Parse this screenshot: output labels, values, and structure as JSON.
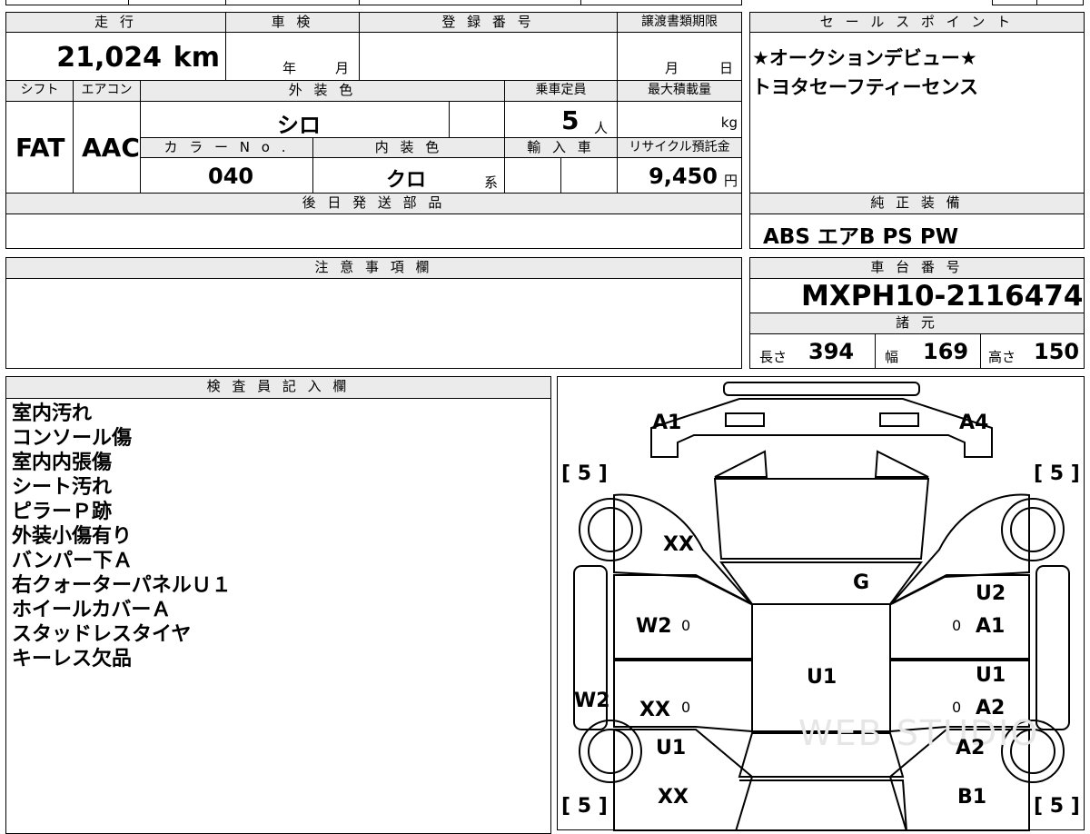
{
  "top": {
    "mileage_label": "走 行",
    "mileage_value": "21,024",
    "mileage_unit": "km",
    "inspection_label": "車 検",
    "inspection_year": "年",
    "inspection_month": "月",
    "registration_label": "登 録 番 号",
    "transfer_label": "譲渡書類期限",
    "transfer_month": "月",
    "transfer_day": "日"
  },
  "row2": {
    "shift_label": "シフト",
    "shift_value": "FAT",
    "ac_label": "エアコン",
    "ac_value": "AAC",
    "exterior_label": "外 装 色",
    "exterior_value": "シロ",
    "capacity_label": "乗車定員",
    "capacity_value": "5",
    "capacity_unit": "人",
    "maxload_label": "最大積載量",
    "maxload_unit": "kg",
    "color_no_label": "カ ラ ー N o .",
    "color_no_value": "040",
    "interior_label": "内 装 色",
    "interior_value": "クロ",
    "interior_suffix": "系",
    "import_label": "輸 入 車",
    "recycle_label": "リサイクル預託金",
    "recycle_value": "9,450",
    "recycle_unit": "円"
  },
  "later_parts_label": "後 日 発 送 部 品",
  "notes_label": "注 意 事 項 欄",
  "sales_points": {
    "label": "セ ー ル ス ポ イ ン ト",
    "lines": [
      "★オークションデビュー★",
      "トヨタセーフティーセンス"
    ]
  },
  "equipment": {
    "label": "純 正 装 備",
    "value": "ABS エアB PS PW"
  },
  "chassis": {
    "label": "車 台 番 号",
    "value": "MXPH10-2116474"
  },
  "specs": {
    "label": "諸 元",
    "length_label": "長さ",
    "length_value": "394",
    "width_label": "幅",
    "width_value": "169",
    "height_label": "高さ",
    "height_value": "150"
  },
  "inspector": {
    "label": "検 査 員 記 入 欄",
    "notes": [
      "室内汚れ",
      "コンソール傷",
      "室内内張傷",
      "シート汚れ",
      "ピラーＰ跡",
      "外装小傷有り",
      "バンパー下Ａ",
      "右クォーターパネルＵ１",
      "ホイールカバーＡ",
      "スタッドレスタイヤ",
      "キーレス欠品"
    ]
  },
  "diagram": {
    "marks": {
      "front_left": "A1",
      "front_right": "A4",
      "front_left_fender": "XX",
      "hood": "G",
      "right_front_door_top": "U2",
      "right_front_door": "A1",
      "left_front_door": "W2",
      "roof": "U1",
      "left_side_sill": "W2",
      "left_rear_door": "XX",
      "right_rear_door_top": "U1",
      "right_rear_door": "A2",
      "left_rear_fender": "U1",
      "right_rear_fender": "A2",
      "rear_left": "XX",
      "rear_right": "B1"
    },
    "tire_brackets": [
      "5",
      "5",
      "5",
      "5"
    ],
    "zero_marks": [
      "0",
      "0",
      "0",
      "0"
    ],
    "watermark": "WEB STUDIO"
  }
}
